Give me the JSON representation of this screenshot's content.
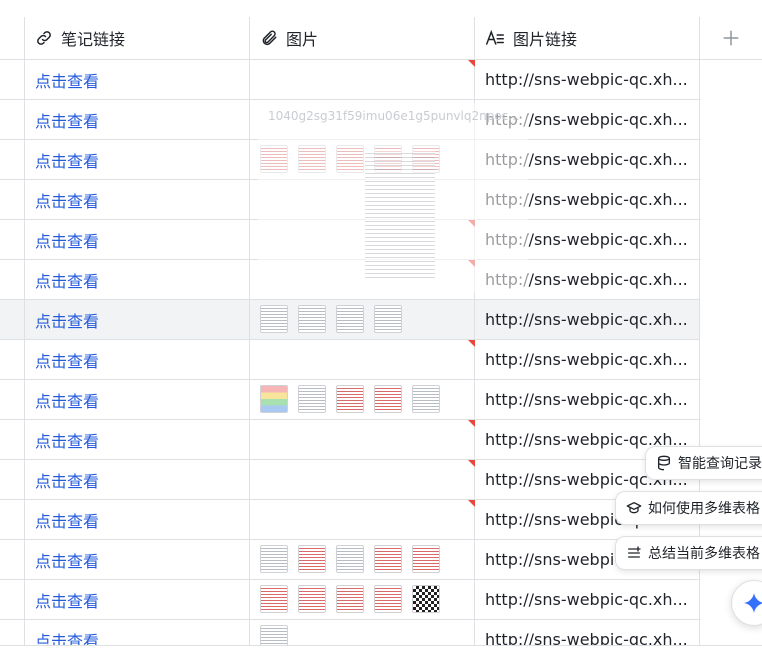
{
  "columns": [
    {
      "key": "note_link",
      "label": "笔记链接",
      "icon": "link-icon"
    },
    {
      "key": "images",
      "label": "图片",
      "icon": "paperclip-icon"
    },
    {
      "key": "image_link",
      "label": "图片链接",
      "icon": "text-field-icon"
    }
  ],
  "add_column_icon": "plus-icon",
  "rows": [
    {
      "link": "点击查看",
      "url": "http://sns-webpic-qc.xh...",
      "thumbs": [],
      "flag": true
    },
    {
      "link": "点击查看",
      "url": "http://sns-webpic-qc.xh...",
      "thumbs": [],
      "flag": false
    },
    {
      "link": "点击查看",
      "url": "http://sns-webpic-qc.xh...",
      "thumbs": [
        "red",
        "red",
        "red",
        "red",
        "red"
      ],
      "flag": false
    },
    {
      "link": "点击查看",
      "url": "http://sns-webpic-qc.xh...",
      "thumbs": [],
      "flag": false
    },
    {
      "link": "点击查看",
      "url": "http://sns-webpic-qc.xh...",
      "thumbs": [],
      "flag": true
    },
    {
      "link": "点击查看",
      "url": "http://sns-webpic-qc.xh...",
      "thumbs": [],
      "flag": true
    },
    {
      "link": "点击查看",
      "url": "http://sns-webpic-qc.xh...",
      "thumbs": [
        "gray",
        "gray",
        "gray",
        "gray"
      ],
      "flag": false,
      "highlight": true
    },
    {
      "link": "点击查看",
      "url": "http://sns-webpic-qc.xh...",
      "thumbs": [],
      "flag": true
    },
    {
      "link": "点击查看",
      "url": "http://sns-webpic-qc.xh...",
      "thumbs": [
        "color",
        "gray",
        "red",
        "red",
        "gray"
      ],
      "flag": false
    },
    {
      "link": "点击查看",
      "url": "http://sns-webpic-qc.xh...",
      "thumbs": [],
      "flag": true
    },
    {
      "link": "点击查看",
      "url": "http://sns-webpic-qc.xh...",
      "thumbs": [],
      "flag": true
    },
    {
      "link": "点击查看",
      "url": "http://sns-webpic-qc.xh...",
      "thumbs": [],
      "flag": true
    },
    {
      "link": "点击查看",
      "url": "http://sns-webpic-qc.xh...",
      "thumbs": [
        "gray",
        "red",
        "gray",
        "red",
        "red"
      ],
      "flag": false
    },
    {
      "link": "点击查看",
      "url": "http://sns-webpic-qc.xh...",
      "thumbs": [
        "red",
        "red",
        "red",
        "red",
        "qr"
      ],
      "flag": false
    },
    {
      "link": "点击查看",
      "url": "http://sns-webpic-qc.xh...",
      "thumbs": [
        "gray"
      ],
      "flag": false
    }
  ],
  "preview": {
    "filename": "1040g2sg31f59imu06e1g5punvlq2npoc..."
  },
  "assistant_chips": [
    {
      "label": "智能查询记录",
      "icon": "database-icon"
    },
    {
      "label": "如何使用多维表格",
      "icon": "graduation-cap-icon"
    },
    {
      "label": "总结当前多维表格",
      "icon": "summary-list-icon"
    }
  ],
  "assistant_fab_icon": "sparkle-icon",
  "colors": {
    "link": "#245bdb",
    "border": "#dee0e3",
    "flag": "#e8453c",
    "highlight_row": "#f2f3f5"
  }
}
